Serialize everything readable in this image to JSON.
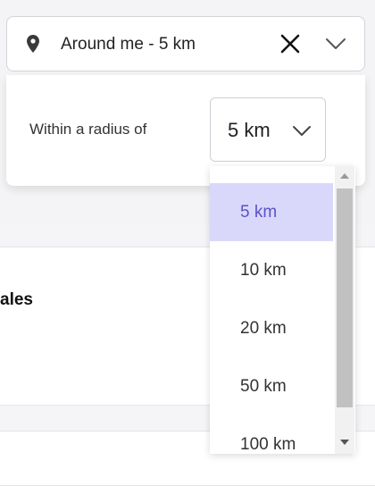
{
  "location": {
    "label": "Around me - 5 km"
  },
  "radius": {
    "label": "Within a radius of",
    "value": "5 km",
    "options": [
      "5 km",
      "10 km",
      "20 km",
      "50 km",
      "100 km"
    ],
    "selected_index": 0
  },
  "background": {
    "card_text": "ales"
  },
  "colors": {
    "selected_bg": "#d9d8fb",
    "selected_text": "#5b52c8"
  },
  "icons": [
    "map-pin-icon",
    "close-icon",
    "chevron-down-icon"
  ]
}
